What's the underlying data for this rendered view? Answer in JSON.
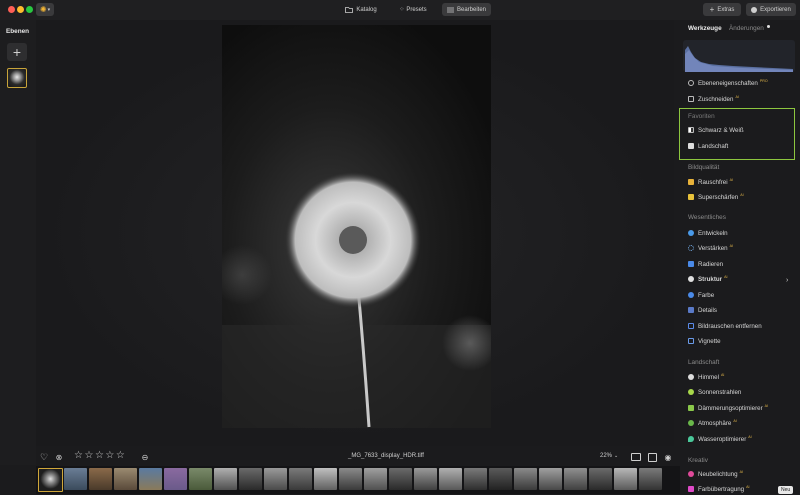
{
  "toolbar": {
    "katalog_label": "Katalog",
    "presets_label": "Presets",
    "bearbeiten_label": "Bearbeiten",
    "extras_label": "Extras",
    "exportieren_label": "Exportieren"
  },
  "layers": {
    "title": "Ebenen"
  },
  "panel": {
    "tabs": {
      "werkzeuge": "Werkzeuge",
      "aenderungen": "Änderungen"
    },
    "top_items": [
      {
        "label": "Ebeneneigenschaften",
        "badge": "PRO",
        "icon": "layers-icon"
      },
      {
        "label": "Zuschneiden",
        "badge": "AI",
        "icon": "crop-icon"
      }
    ],
    "favoriten": {
      "title": "Favoriten",
      "items": [
        {
          "label": "Schwarz & Weiß",
          "icon": "bw-icon"
        },
        {
          "label": "Landschaft",
          "icon": "landscape-icon"
        }
      ]
    },
    "bildqualitaet": {
      "title": "Bildqualität",
      "items": [
        {
          "label": "Rauschfrei",
          "badge": "AI",
          "icon": "noise-icon"
        },
        {
          "label": "Superschärfen",
          "badge": "AI",
          "icon": "sharpen-icon"
        }
      ]
    },
    "wesentliches": {
      "title": "Wesentliches",
      "items": [
        {
          "label": "Entwickeln",
          "icon": "develop-icon"
        },
        {
          "label": "Verstärken",
          "badge": "AI",
          "icon": "enhance-icon"
        },
        {
          "label": "Radieren",
          "icon": "erase-icon"
        },
        {
          "label": "Struktur",
          "badge": "AI",
          "icon": "structure-icon"
        },
        {
          "label": "Farbe",
          "icon": "color-icon"
        },
        {
          "label": "Details",
          "icon": "details-icon"
        },
        {
          "label": "Bildrauschen entfernen",
          "icon": "denoise-icon"
        },
        {
          "label": "Vignette",
          "icon": "vignette-icon"
        }
      ]
    },
    "landschaft": {
      "title": "Landschaft",
      "items": [
        {
          "label": "Himmel",
          "badge": "AI",
          "icon": "cloud-icon"
        },
        {
          "label": "Sonnenstrahlen",
          "icon": "sun-icon"
        },
        {
          "label": "Dämmerungsoptimierer",
          "badge": "AI",
          "icon": "dusk-icon"
        },
        {
          "label": "Atmosphäre",
          "badge": "AI",
          "icon": "atmosphere-icon"
        },
        {
          "label": "Wasseroptimierer",
          "badge": "AI",
          "icon": "water-icon"
        }
      ]
    },
    "kreativ": {
      "title": "Kreativ",
      "items": [
        {
          "label": "Neubelichtung",
          "badge": "AI",
          "icon": "relight-icon"
        },
        {
          "label": "Farbübertragung",
          "badge": "AI",
          "icon": "color-transfer-icon",
          "tag": "Neu"
        }
      ]
    }
  },
  "bottom": {
    "filename": "_MG_7633_display_HDR.tiff",
    "zoom": "22%"
  },
  "colors": {
    "accent_green": "#8dc63f",
    "badge_gold": "#e2b64a"
  }
}
